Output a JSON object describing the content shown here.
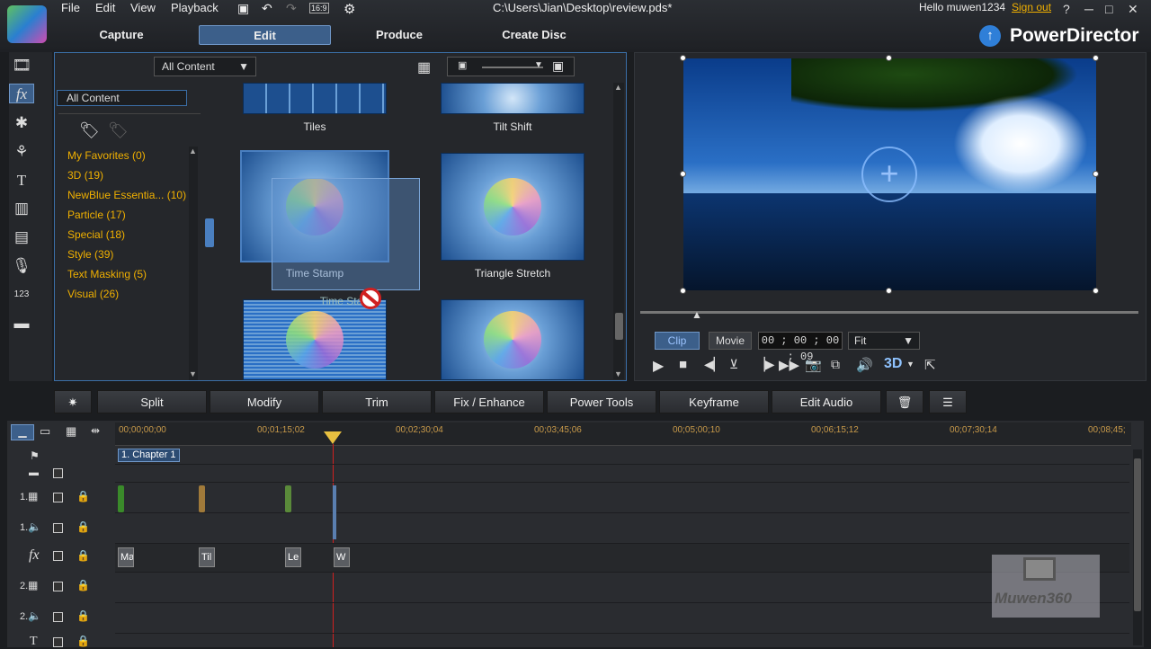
{
  "window": {
    "menu": [
      "File",
      "Edit",
      "View",
      "Playback"
    ],
    "aspect_label": "16:9",
    "file_path": "C:\\Users\\Jian\\Desktop\\review.pds*",
    "greeting": "Hello muwen1234",
    "signout": "Sign out",
    "help": "?",
    "minimize": "─",
    "maximize": "□",
    "close": "✕"
  },
  "modes": {
    "capture": "Capture",
    "edit": "Edit",
    "produce": "Produce",
    "create_disc": "Create Disc"
  },
  "brand": "PowerDirector",
  "library": {
    "filter_value": "All Content",
    "tree_value": "All Content",
    "categories": [
      {
        "label": "My Favorites",
        "count": "(0)"
      },
      {
        "label": "3D",
        "count": "(19)"
      },
      {
        "label": "NewBlue Essentia...",
        "count": "(10)"
      },
      {
        "label": "Particle",
        "count": "(17)"
      },
      {
        "label": "Special",
        "count": "(18)"
      },
      {
        "label": "Style",
        "count": "(39)"
      },
      {
        "label": "Text Masking",
        "count": "(5)"
      },
      {
        "label": "Visual",
        "count": "(26)"
      }
    ],
    "effects": [
      "Tiles",
      "Tilt Shift",
      "Time Stamp",
      "Triangle Stretch"
    ],
    "drag_label": "Time Stamp",
    "drag_label_2": "Time Sta"
  },
  "preview": {
    "mode_clip": "Clip",
    "mode_movie": "Movie",
    "timecode": "00 ; 00 ; 00 ; 09",
    "zoom": "Fit",
    "three_d": "3D"
  },
  "toolbar": {
    "split": "Split",
    "modify": "Modify",
    "trim": "Trim",
    "fix": "Fix / Enhance",
    "power_tools": "Power Tools",
    "keyframe": "Keyframe",
    "edit_audio": "Edit Audio"
  },
  "timeline": {
    "ruler": [
      "00;00;00;00",
      "00;01;15;02",
      "00;02;30;04",
      "00;03;45;06",
      "00;05;00;10",
      "00;06;15;12",
      "00;07;30;14",
      "00;08;45;"
    ],
    "chapter": "1. Chapter 1",
    "fx_clips": [
      "Ma",
      "Til",
      "Le",
      "W"
    ],
    "track_labels": [
      "1.",
      "1.",
      "2.",
      "2."
    ],
    "fx_label": "fx",
    "title_label": "T"
  },
  "watermark": "Muwen360",
  "colors": {
    "accent": "#3b6fa8",
    "category": "#f0b000",
    "ruler": "#c89a4a",
    "playhead": "#d02020"
  }
}
